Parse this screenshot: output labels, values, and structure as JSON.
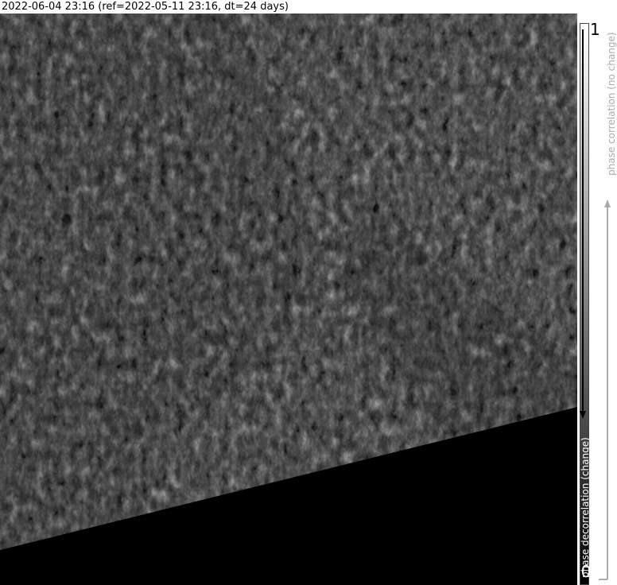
{
  "header": {
    "title": "2022-06-04 23:16 (ref=2022-05-11 23:16, dt=24 days)"
  },
  "image": {
    "description_name": "sar-coherence-map"
  },
  "colorbar": {
    "max_label": "1",
    "min_label": "0",
    "top_caption": "phase correlation (no change)",
    "bottom_caption": "phase decorrelation (change)"
  }
}
